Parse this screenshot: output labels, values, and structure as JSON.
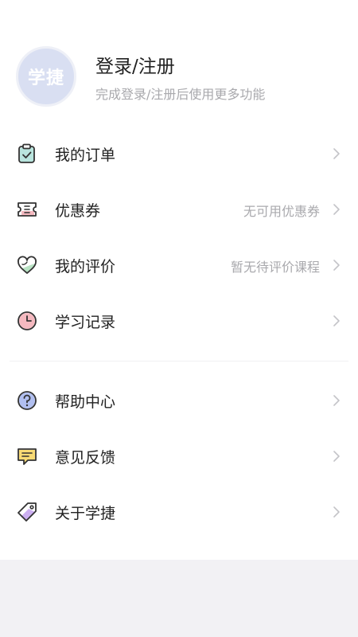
{
  "profile": {
    "avatar_text": "学捷",
    "title": "登录/注册",
    "subtitle": "完成登录/注册后使用更多功能"
  },
  "menu_main": [
    {
      "label": "我的订单",
      "value": "",
      "icon": "clipboard-check-icon"
    },
    {
      "label": "优惠券",
      "value": "无可用优惠券",
      "icon": "ticket-icon"
    },
    {
      "label": "我的评价",
      "value": "暂无待评价课程",
      "icon": "heart-icon"
    },
    {
      "label": "学习记录",
      "value": "",
      "icon": "clock-icon"
    }
  ],
  "menu_secondary": [
    {
      "label": "帮助中心",
      "value": "",
      "icon": "help-circle-icon"
    },
    {
      "label": "意见反馈",
      "value": "",
      "icon": "feedback-message-icon"
    },
    {
      "label": "关于学捷",
      "value": "",
      "icon": "tag-icon"
    }
  ],
  "colors": {
    "accent_teal": "#7fd0c2",
    "accent_pink": "#f2a7b0",
    "accent_green": "#b9e3c4",
    "accent_blue": "#a9b8ee",
    "accent_yellow": "#f7d45c",
    "accent_purple": "#c7a6f0",
    "stroke": "#333333",
    "chevron": "#c4c4c8"
  }
}
